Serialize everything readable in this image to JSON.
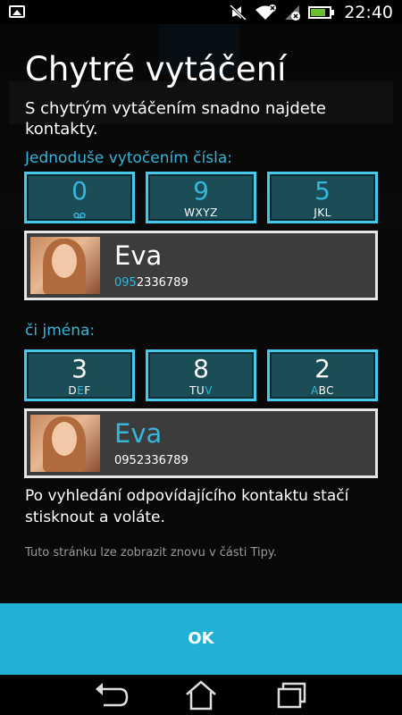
{
  "status_bar": {
    "time": "22:40"
  },
  "tutorial": {
    "title": "Chytré vytáčení",
    "subtitle": "S chytrým vytáčením snadno najdete kontakty.",
    "section_numbers": "Jednoduše vytočením čísla:",
    "keys_numbers": [
      {
        "digit": "0",
        "letters": ""
      },
      {
        "digit": "9",
        "letters": "WXYZ"
      },
      {
        "digit": "5",
        "letters": "JKL"
      }
    ],
    "contact1": {
      "name": "Eva",
      "number_prefix": "095",
      "number_rest": "2336789"
    },
    "section_names": "či jména:",
    "keys_names": [
      {
        "digit": "3",
        "letters_before": "D",
        "letters_hl": "E",
        "letters_after": "F"
      },
      {
        "digit": "8",
        "letters_before": "TU",
        "letters_hl": "V",
        "letters_after": ""
      },
      {
        "digit": "2",
        "letters_before": "",
        "letters_hl": "A",
        "letters_after": "BC"
      }
    ],
    "contact2": {
      "name": "Eva",
      "number": "0952336789"
    },
    "body": "Po vyhledání odpovídajícího kontaktu stačí stisknout a voláte.",
    "tip": "Tuto stránku lze zobrazit znovu v části Tipy.",
    "ok_label": "OK"
  },
  "colors": {
    "accent": "#35b6da",
    "ok_button": "#21b0d6",
    "key_bg": "#1b4d57",
    "key_border": "#46c8ea"
  },
  "icons": [
    "gallery-icon",
    "mute-icon",
    "wifi-icon",
    "signal-icon",
    "battery-icon",
    "voicemail-icon",
    "back-icon",
    "home-icon",
    "recent-apps-icon"
  ]
}
